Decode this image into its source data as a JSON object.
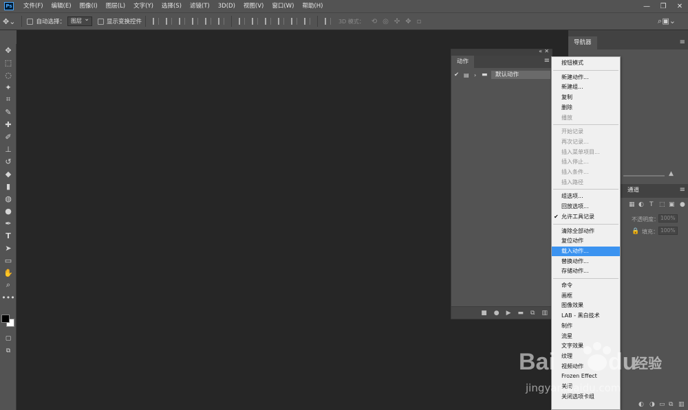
{
  "app": {
    "logo_text": "Ps",
    "accent": "#31a8ff"
  },
  "menubar": {
    "items": [
      "文件(F)",
      "编辑(E)",
      "图像(I)",
      "图层(L)",
      "文字(Y)",
      "选择(S)",
      "滤镜(T)",
      "3D(D)",
      "视图(V)",
      "窗口(W)",
      "帮助(H)"
    ],
    "window_controls": [
      "minimize-icon",
      "restore-icon",
      "close-icon"
    ]
  },
  "options": {
    "auto_select_label": "自动选择：",
    "auto_select_value": "图层",
    "show_transform_label": "显示变换控件",
    "mode_3d_label": "3D 模式："
  },
  "tools": [
    "move-icon",
    "marquee-icon",
    "lasso-icon",
    "magic-wand-icon",
    "crop-icon",
    "eyedropper-icon",
    "healing-brush-icon",
    "brush-icon",
    "clone-stamp-icon",
    "history-brush-icon",
    "eraser-icon",
    "gradient-icon",
    "blur-icon",
    "dodge-icon",
    "pen-icon",
    "type-icon",
    "path-select-icon",
    "rectangle-icon",
    "hand-icon",
    "zoom-icon",
    "more-tools-icon"
  ],
  "colors": {
    "foreground": "#000000",
    "background": "#ffffff"
  },
  "dock": {
    "navigator_tab": "导航器",
    "channels_tab": "通道",
    "opacity_label": "不透明度：",
    "opacity_value": "100%",
    "fill_label": "填充：",
    "fill_value": "100%"
  },
  "actions_panel": {
    "tab_label": "动作",
    "rows": [
      {
        "checked": true,
        "name": "默认动作"
      }
    ]
  },
  "flyout": {
    "groups": [
      [
        {
          "label": "按钮模式"
        }
      ],
      [
        {
          "label": "新建动作..."
        },
        {
          "label": "新建组..."
        },
        {
          "label": "复制"
        },
        {
          "label": "删除"
        },
        {
          "label": "播放",
          "disabled": true
        }
      ],
      [
        {
          "label": "开始记录",
          "disabled": true
        },
        {
          "label": "再次记录...",
          "disabled": true
        },
        {
          "label": "插入菜单项目...",
          "disabled": true
        },
        {
          "label": "插入停止...",
          "disabled": true
        },
        {
          "label": "插入条件...",
          "disabled": true
        },
        {
          "label": "插入路径",
          "disabled": true
        }
      ],
      [
        {
          "label": "组选项..."
        },
        {
          "label": "回放选项..."
        },
        {
          "label": "允许工具记录",
          "checked": true
        }
      ],
      [
        {
          "label": "清除全部动作"
        },
        {
          "label": "复位动作"
        },
        {
          "label": "载入动作...",
          "highlighted": true
        },
        {
          "label": "替换动作..."
        },
        {
          "label": "存储动作..."
        }
      ],
      [
        {
          "label": "命令"
        },
        {
          "label": "画框"
        },
        {
          "label": "图像效果"
        },
        {
          "label": "LAB - 黑白技术"
        },
        {
          "label": "制作"
        },
        {
          "label": "流星"
        },
        {
          "label": "文字效果"
        },
        {
          "label": "纹理"
        },
        {
          "label": "视频动作"
        },
        {
          "label": "Frozen Effect"
        },
        {
          "label": "关闭"
        },
        {
          "label": "关闭选项卡组"
        }
      ]
    ]
  },
  "watermark": {
    "brand": "Bai",
    "brand2": "du",
    "suffix": "经验",
    "url": "jingyan.baidu.com"
  }
}
